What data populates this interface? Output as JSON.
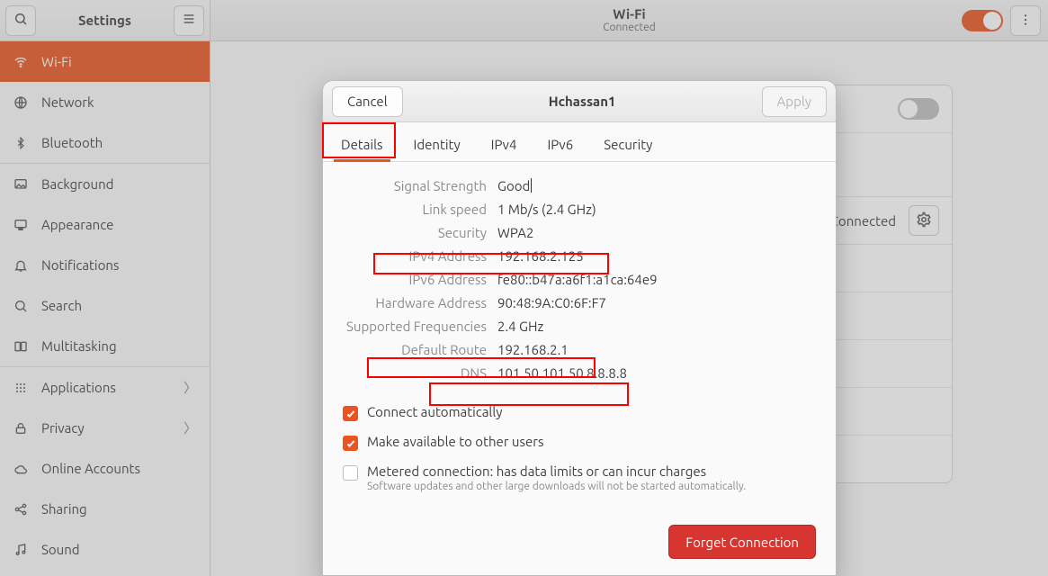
{
  "header": {
    "sidebar_title": "Settings",
    "content_title": "Wi-Fi",
    "content_sub": "Connected"
  },
  "sidebar": {
    "items": [
      {
        "label": "Wi-Fi"
      },
      {
        "label": "Network"
      },
      {
        "label": "Bluetooth"
      },
      {
        "label": "Background"
      },
      {
        "label": "Appearance"
      },
      {
        "label": "Notifications"
      },
      {
        "label": "Search"
      },
      {
        "label": "Multitasking"
      },
      {
        "label": "Applications"
      },
      {
        "label": "Privacy"
      },
      {
        "label": "Online Accounts"
      },
      {
        "label": "Sharing"
      },
      {
        "label": "Sound"
      }
    ]
  },
  "content": {
    "airplane": {
      "label": "",
      "sub": ""
    },
    "network_row": {
      "status": "Connected"
    }
  },
  "dialog": {
    "title": "Hchassan1",
    "cancel": "Cancel",
    "apply": "Apply",
    "tabs": {
      "details": "Details",
      "identity": "Identity",
      "ipv4": "IPv4",
      "ipv6": "IPv6",
      "security": "Security"
    },
    "details": {
      "k_signal": "Signal Strength",
      "v_signal": "Good",
      "k_speed": "Link speed",
      "v_speed": "1 Mb/s (2.4 GHz)",
      "k_sec": "Security",
      "v_sec": "WPA2",
      "k_ipv4": "IPv4 Address",
      "v_ipv4": "192.168.2.125",
      "k_ipv6": "IPv6 Address",
      "v_ipv6": "fe80::b47a:a6f1:a1ca:64e9",
      "k_hw": "Hardware Address",
      "v_hw": "90:48:9A:C0:6F:F7",
      "k_freq": "Supported Frequencies",
      "v_freq": "2.4 GHz",
      "k_route": "Default Route",
      "v_route": "192.168.2.1",
      "k_dns": "DNS",
      "v_dns": "101.50.101.50 8.8.8.8"
    },
    "checks": {
      "auto": "Connect automatically",
      "share": "Make available to other users",
      "metered": "Metered connection: has data limits or can incur charges",
      "metered_sub": "Software updates and other large downloads will not be started automatically."
    },
    "forget": "Forget Connection"
  },
  "colors": {
    "accent": "#e95420",
    "danger": "#d7352f"
  }
}
